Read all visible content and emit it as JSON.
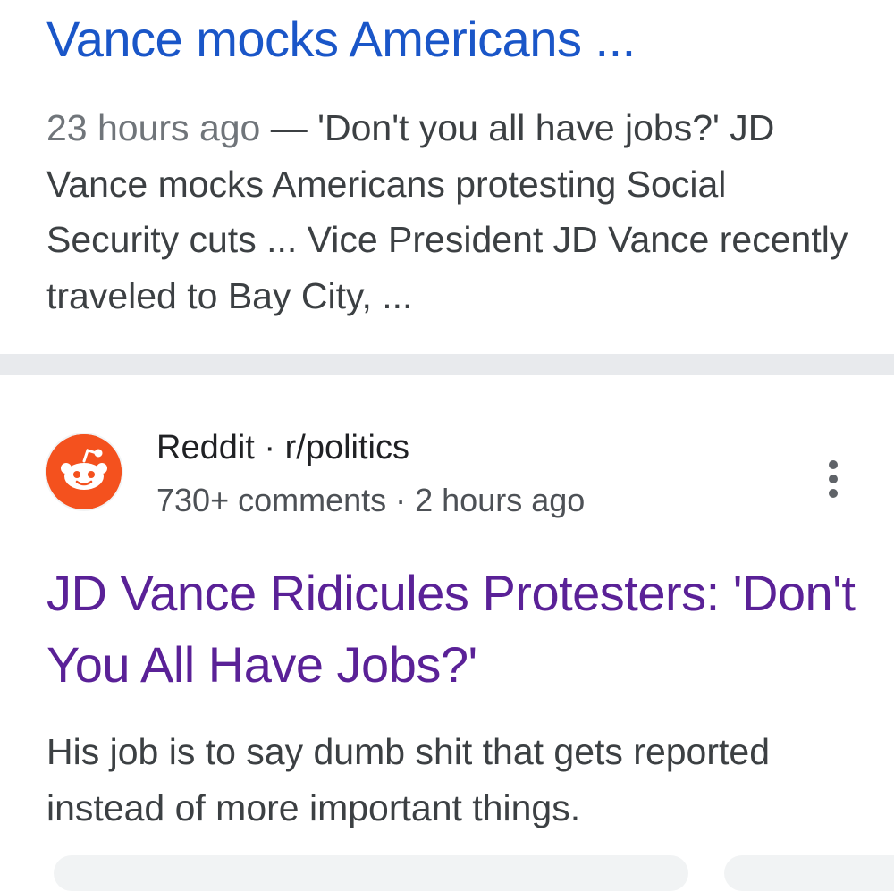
{
  "result_1": {
    "title": "Vance mocks Americans ...",
    "date": "23 hours ago",
    "separator": " — ",
    "snippet": "'Don't you all have jobs?' JD Vance mocks Americans protesting Social Security cuts ... Vice President JD Vance recently traveled to Bay City, ..."
  },
  "result_2": {
    "favicon": "reddit-logo",
    "source": "Reddit · r/politics",
    "meta": "730+ comments · 2 hours ago",
    "more_icon": "more-vert-icon",
    "title": "JD Vance Ridicules Protesters: 'Don't You All Have Jobs?'",
    "snippet": "His job is to say dumb shit that gets reported instead of more important things."
  },
  "colors": {
    "link_unvisited": "#1a56c8",
    "link_visited": "#5a2197",
    "snippet_text": "#3c4043",
    "reddit_orange": "#f4511e",
    "divider": "#e8eaed"
  }
}
